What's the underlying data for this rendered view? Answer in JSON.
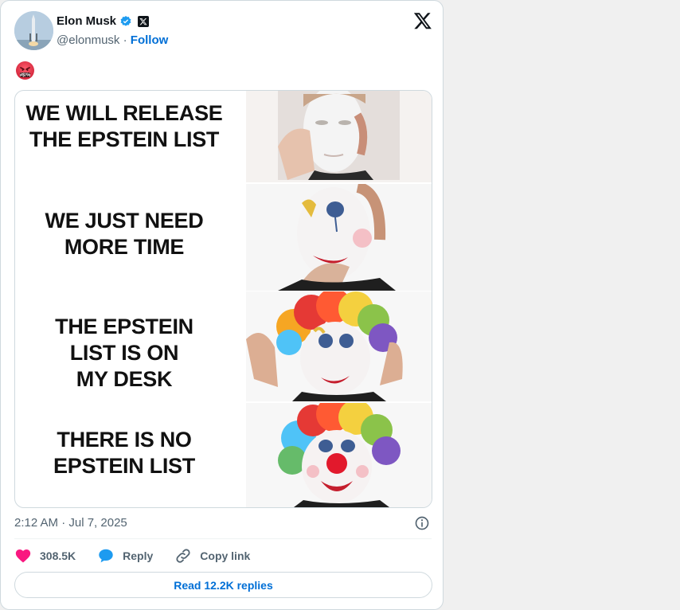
{
  "author": {
    "name": "Elon Musk",
    "handle": "@elonmusk",
    "separator": " · ",
    "follow_label": "Follow"
  },
  "tweet": {
    "emoji_badge_text": "#$!%",
    "meme_panels": [
      {
        "line1": "WE WILL RELEASE",
        "line2": "THE EPSTEIN LIST",
        "line3": ""
      },
      {
        "line1": "WE JUST NEED",
        "line2": "MORE TIME",
        "line3": ""
      },
      {
        "line1": "THE EPSTEIN",
        "line2": "LIST IS ON",
        "line3": "MY DESK"
      },
      {
        "line1": "THERE IS NO",
        "line2": "EPSTEIN LIST",
        "line3": ""
      }
    ],
    "timestamp": "2:12 AM · Jul 7, 2025"
  },
  "actions": {
    "likes": "308.5K",
    "reply_label": "Reply",
    "copy_link_label": "Copy link"
  },
  "read_replies_label": "Read 12.2K replies",
  "icons": {
    "verified": "verified-badge-icon",
    "x_affiliate": "x-affiliate-icon",
    "x_logo": "x-logo-icon",
    "info": "info-icon",
    "heart": "heart-icon",
    "reply": "reply-bubble-icon",
    "link": "link-icon"
  },
  "colors": {
    "accent": "#006fd6",
    "verified": "#1d9bf0",
    "like": "#f91880",
    "muted": "#536471"
  }
}
